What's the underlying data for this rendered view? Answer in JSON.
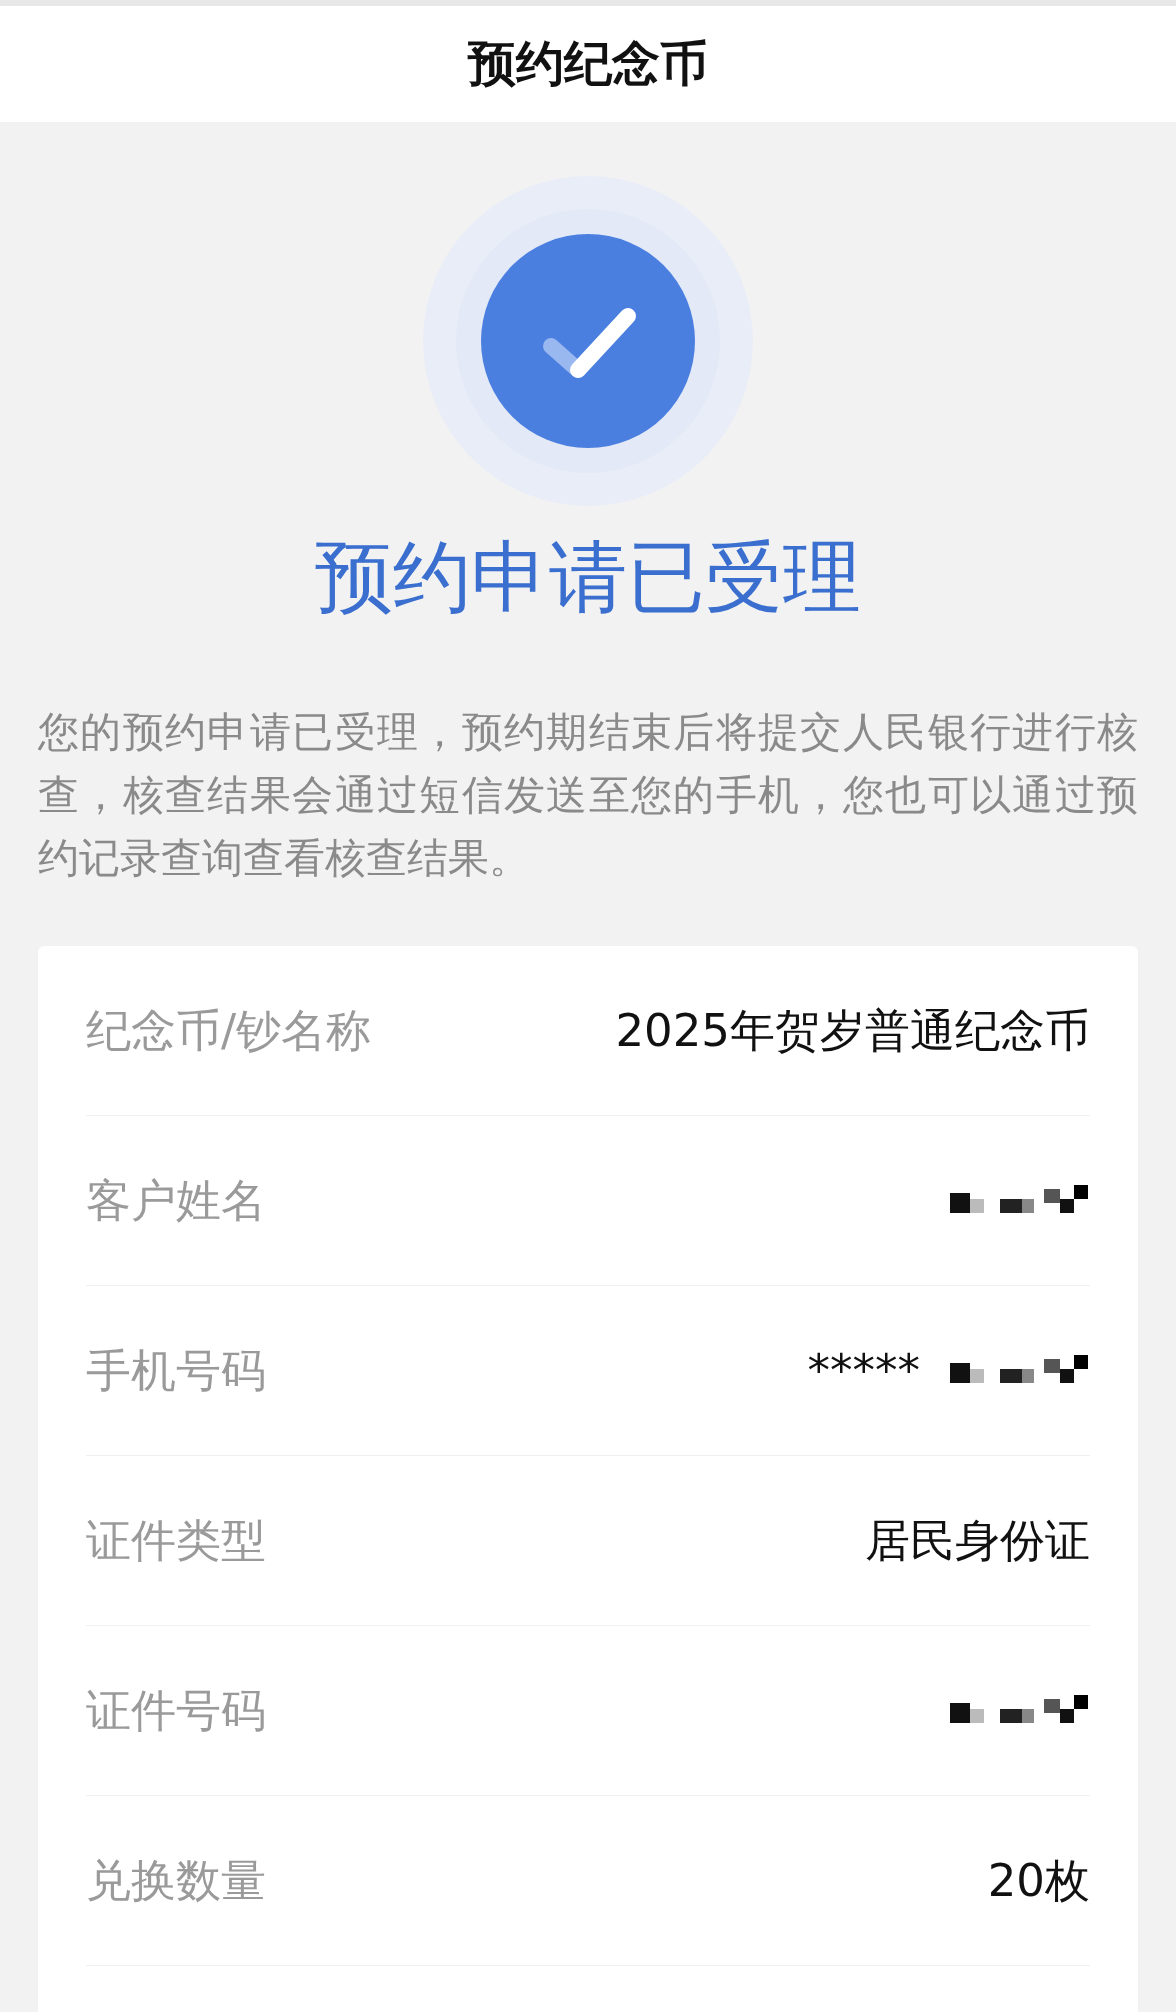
{
  "header": {
    "title": "预约纪念币"
  },
  "result": {
    "heading": "预约申请已受理",
    "message": "您的预约申请已受理，预约期结束后将提交人民银行进行核查，核查结果会通过短信发送至您的手机，您也可以通过预约记录查询查看核查结果。"
  },
  "details": [
    {
      "label": "纪念币/钞名称",
      "value": "2025年贺岁普通纪念币",
      "masked": false
    },
    {
      "label": "客户姓名",
      "masked": true
    },
    {
      "label": "手机号码",
      "value": "*****",
      "masked": true
    },
    {
      "label": "证件类型",
      "value": "居民身份证",
      "masked": false
    },
    {
      "label": "证件号码",
      "masked": true
    },
    {
      "label": "兑换数量",
      "value": "20枚",
      "masked": false
    }
  ]
}
